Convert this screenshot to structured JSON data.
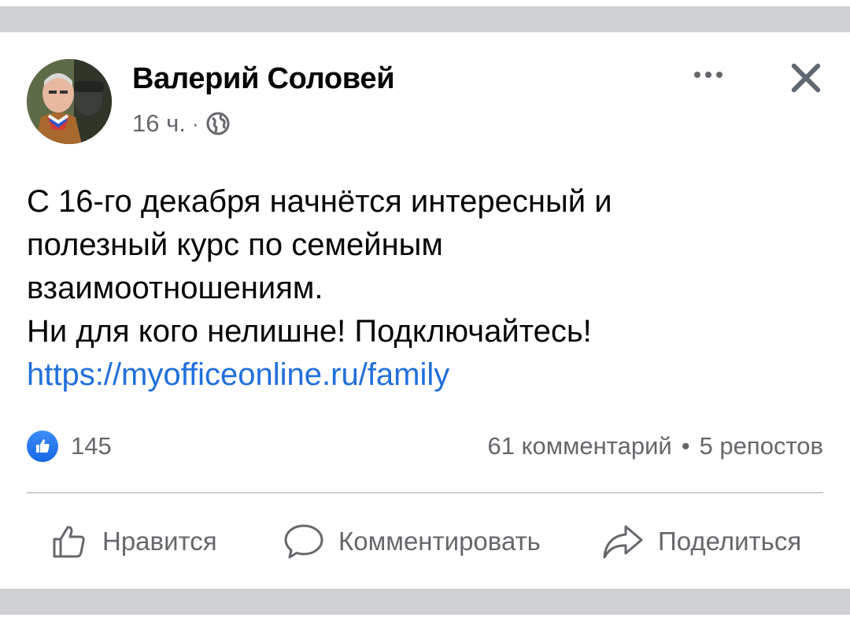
{
  "post": {
    "author": "Валерий Соловей",
    "time": "16 ч.",
    "separator": "·",
    "privacy_icon": "globe-icon",
    "text_lines": [
      "С 16-го декабря начнётся интересный и",
      "полезный курс по семейным",
      "взаимоотношениям.",
      "Ни для кого нелишне! Подключайтесь!"
    ],
    "link": "https://myofficeonline.ru/family"
  },
  "stats": {
    "likes": "145",
    "comments": "61 комментарий",
    "separator": "•",
    "shares": "5 репостов"
  },
  "actions": {
    "like_label": "Нравится",
    "comment_label": "Комментировать",
    "share_label": "Поделиться"
  },
  "colors": {
    "link": "#216fdb",
    "secondary_text": "#65676b",
    "like_badge": "#1877f2",
    "band": "#ced0d4"
  }
}
